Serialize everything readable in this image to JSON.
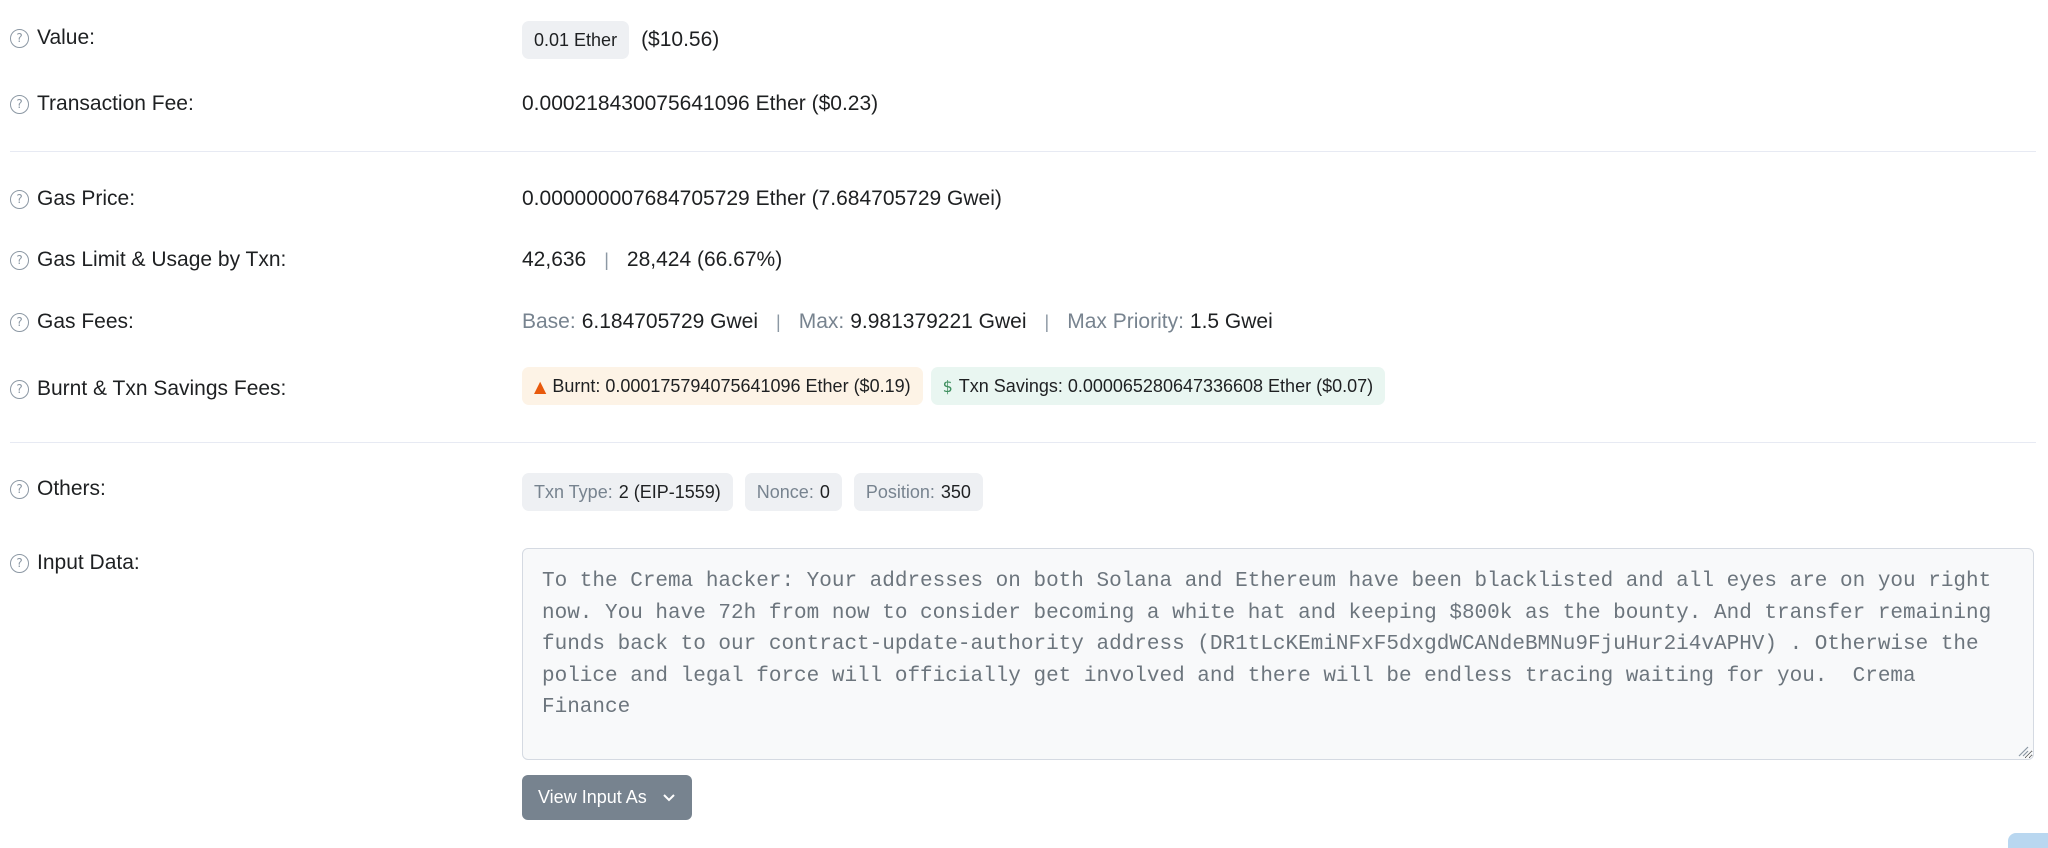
{
  "value": {
    "label": "Value:",
    "amount_badge": "0.01 Ether",
    "usd": "($10.56)"
  },
  "transaction_fee": {
    "label": "Transaction Fee:",
    "value": "0.000218430075641096 Ether ($0.23)"
  },
  "gas_price": {
    "label": "Gas Price:",
    "value": "0.000000007684705729 Ether (7.684705729 Gwei)"
  },
  "gas_limit": {
    "label": "Gas Limit & Usage by Txn:",
    "limit": "42,636",
    "separator": "|",
    "usage": "28,424 (66.67%)"
  },
  "gas_fees": {
    "label": "Gas Fees:",
    "base_label": "Base:",
    "base_value": "6.184705729 Gwei",
    "max_label": "Max:",
    "max_value": "9.981379221 Gwei",
    "priority_label": "Max Priority:",
    "priority_value": "1.5 Gwei",
    "separator": "|"
  },
  "burnt_savings": {
    "label": "Burnt & Txn Savings Fees:",
    "burnt_icon": "fire-icon",
    "burnt_text": "Burnt: 0.000175794075641096 Ether ($0.19)",
    "savings_icon": "money-wings-icon",
    "savings_text": "Txn Savings: 0.000065280647336608 Ether ($0.07)"
  },
  "others": {
    "label": "Others:",
    "txn_type_label": "Txn Type:",
    "txn_type_value": "2 (EIP-1559)",
    "nonce_label": "Nonce:",
    "nonce_value": "0",
    "position_label": "Position:",
    "position_value": "350"
  },
  "input_data": {
    "label": "Input Data:",
    "text": "To the Crema hacker: Your addresses on both Solana and Ethereum have been blacklisted and all eyes are on you right now. You have 72h from now to consider becoming a white hat and keeping $800k as the bounty. And transfer remaining funds back to our contract-update-authority address (DR1tLcKEmiNFxF5dxgdWCANdeBMNu9FjuHur2i4vAPHV) . Otherwise the police and legal force will officially get involved and there will be endless tracing waiting for you.  Crema Finance",
    "view_button": "View Input As"
  },
  "icons": {
    "help": "question-circle-icon",
    "chevron": "chevron-down-icon"
  },
  "colors": {
    "muted": "#77838f",
    "burnt_bg": "#fdf3e6",
    "savings_bg": "#e9f6f1",
    "badge_bg": "#eef0f3",
    "button_bg": "#77838f"
  }
}
